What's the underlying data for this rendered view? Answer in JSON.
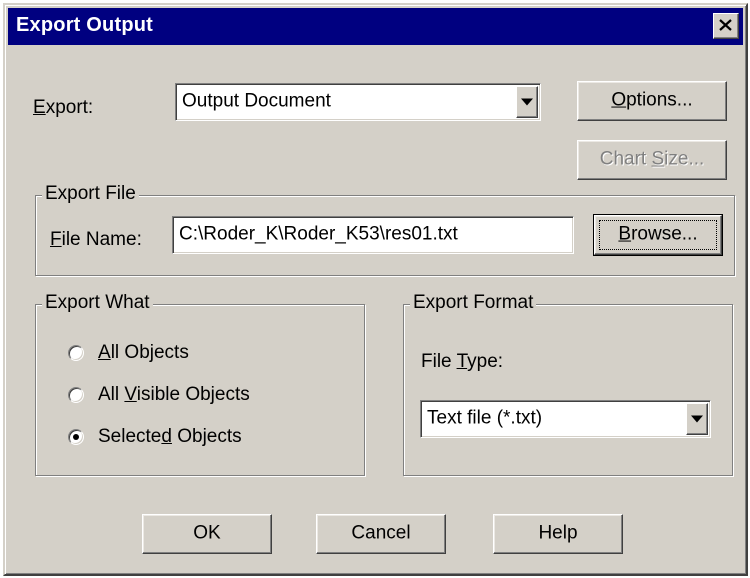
{
  "window": {
    "title": "Export Output"
  },
  "export": {
    "label": "Export:",
    "label_key": "E",
    "label_rest": "xport:",
    "selected": "Output Document",
    "options_button": {
      "key": "O",
      "rest": "ptions..."
    },
    "chart_size_button": {
      "pre": "Chart ",
      "key": "S",
      "post": "ize..."
    }
  },
  "export_file": {
    "group_title": "Export File",
    "label_key": "F",
    "label_rest": "ile Name:",
    "value": "C:\\Roder_K\\Roder_K53\\res01.txt",
    "browse_button": {
      "key": "B",
      "rest": "rowse..."
    }
  },
  "export_what": {
    "group_title": "Export What",
    "options": [
      {
        "key": "A",
        "rest": "ll Objects",
        "pre": "",
        "selected": false
      },
      {
        "pre": "All ",
        "key": "V",
        "rest": "isible Objects",
        "selected": false
      },
      {
        "pre": "Selecte",
        "key": "d",
        "rest": " Objects",
        "selected": true
      }
    ]
  },
  "export_format": {
    "group_title": "Export Format",
    "file_type_pre": "File ",
    "file_type_key": "T",
    "file_type_rest": "ype:",
    "selected": "Text file (*.txt)"
  },
  "buttons": {
    "ok": "OK",
    "cancel": "Cancel",
    "help": "Help"
  },
  "colors": {
    "titlebar": "#000080",
    "face": "#d4d0c8"
  },
  "icons": {
    "close": "close-icon",
    "dropdown": "chevron-down-icon"
  }
}
